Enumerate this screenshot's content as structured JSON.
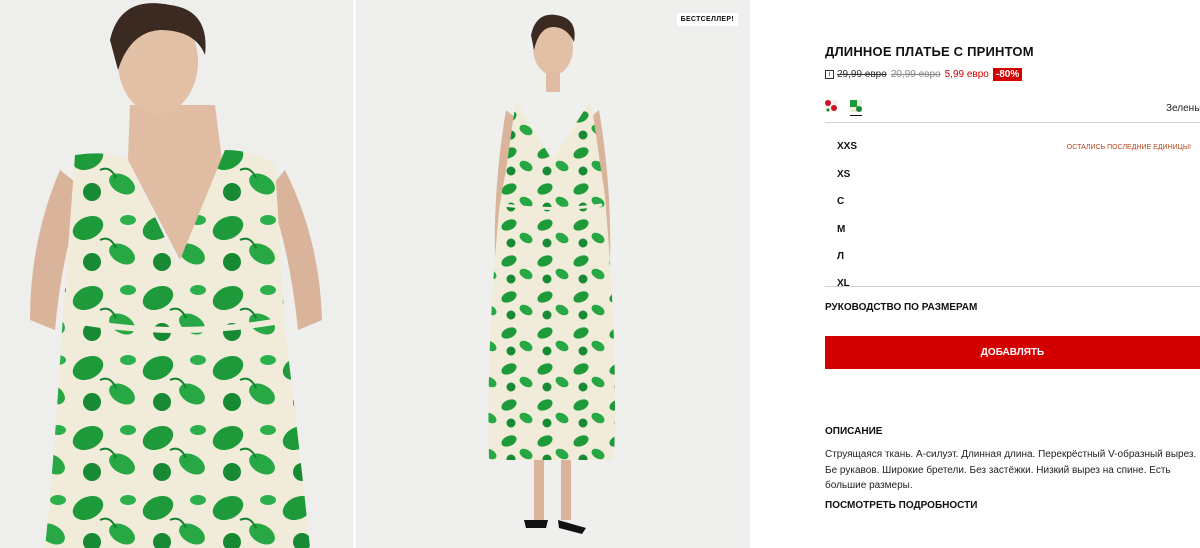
{
  "badge": "БЕСТСЕЛЛЕР!",
  "product": {
    "title": "ДЛИННОЕ ПЛАТЬЕ С ПРИНТОМ",
    "info_icon": "i",
    "price_original": "29,99 евро",
    "price_previous": "20,99 евро",
    "price_sale": "5,99 евро",
    "discount": "-80%",
    "color_name": "Зелены"
  },
  "swatches": [
    {
      "name": "red-print",
      "color": "#d0102a"
    },
    {
      "name": "green-print",
      "color": "#1f9a3a"
    }
  ],
  "sizes": [
    "XXS",
    "XS",
    "С",
    "М",
    "Л",
    "XL"
  ],
  "low_stock": "ОСТАЛИСЬ ПОСЛЕДНИЕ ЕДИНИЦЫ!",
  "size_guide": "РУКОВОДСТВО ПО РАЗМЕРАМ",
  "add_button": "ДОБАВЛЯТЬ",
  "description": {
    "title": "ОПИСАНИЕ",
    "text": "Струящаяся ткань. А-силуэт. Длинная длина. Перекрёстный V-образный вырез. Бе рукавов. Широкие бретели. Без застёжки. Низкий вырез на спине. Есть большие размеры.",
    "details_link": "ПОСМОТРЕТЬ ПОДРОБНОСТИ"
  },
  "colors": {
    "accent": "#d40000",
    "dress_green": "#1f9a3a",
    "dress_cream": "#f1ecd9",
    "photo_bg": "#eeeeec"
  }
}
